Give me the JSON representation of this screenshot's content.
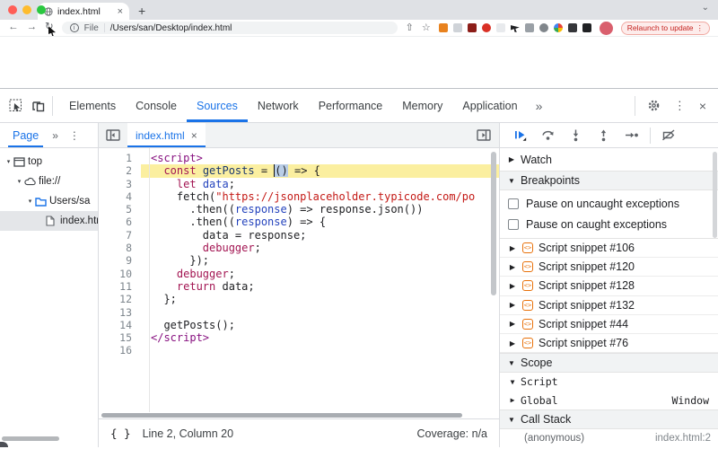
{
  "colors": {
    "accent_blue": "#1a73e8",
    "exec_line_yellow": "#fbefa0",
    "keyword_maroon": "#a31552",
    "tag_purple": "#881280",
    "string_red": "#c41a16",
    "variable_blue": "#2443bd",
    "snippet_orange": "#e8710a",
    "relaunch_red": "#c5221f"
  },
  "browser": {
    "traffic_lights": [
      "#ff5e57",
      "#febc2e",
      "#2ac840"
    ],
    "tab": {
      "title": "index.html",
      "close": "×"
    },
    "new_tab_button": "+",
    "tab_search_chevron": "⌄",
    "nav": {
      "back": "←",
      "forward": "→",
      "reload": "↻"
    },
    "address": {
      "info": "i",
      "scheme_label": "File",
      "path": "/Users/san/Desktop/index.html"
    },
    "actions": {
      "share": "⇧",
      "bookmark": "☆"
    },
    "extensions": [
      {
        "name": "metamask-extension",
        "color": "#e8821e",
        "shape": "square"
      },
      {
        "name": "gray-light-extension",
        "color": "#cfd3d8",
        "shape": "square"
      },
      {
        "name": "dark-red-extension",
        "color": "#8c1d18",
        "shape": "square"
      },
      {
        "name": "red-circle-extension",
        "color": "#d93025",
        "shape": "circle"
      },
      {
        "name": "pale-extension",
        "color": "#e8eaed",
        "shape": "square"
      },
      {
        "name": "cursor-arrow-extension",
        "color": "#202124",
        "shape": "arrow"
      },
      {
        "name": "gray-badge-extension",
        "color": "#9aa0a6",
        "shape": "square"
      },
      {
        "name": "gray-ring-extension",
        "color": "#80868b",
        "shape": "circle"
      },
      {
        "name": "pinwheel-extension",
        "color": "#4285f4",
        "shape": "pinwheel"
      },
      {
        "name": "dark-extension",
        "color": "#35363a",
        "shape": "square"
      },
      {
        "name": "contrast-extension",
        "color": "#202124",
        "shape": "square"
      }
    ],
    "profile": {
      "color": "#d95f6d"
    },
    "relaunch_button": {
      "label": "Relaunch to update",
      "menu": "⋮"
    }
  },
  "devtools": {
    "tabs": [
      "Elements",
      "Console",
      "Sources",
      "Network",
      "Performance",
      "Memory",
      "Application"
    ],
    "active_tab": "Sources",
    "more_tabs": "»",
    "menu": "⋮",
    "close": "×",
    "sidebar": {
      "active_tab": "Page",
      "more": "»",
      "menu": "⋮",
      "tree": [
        {
          "label": "top",
          "icon": "frame",
          "depth": 0,
          "caret": "▾",
          "selected": false
        },
        {
          "label": "file://",
          "icon": "cloud",
          "depth": 1,
          "caret": "▾",
          "selected": false
        },
        {
          "label": "Users/sa",
          "icon": "folder",
          "depth": 2,
          "caret": "▾",
          "selected": false
        },
        {
          "label": "index.html",
          "icon": "file",
          "depth": 3,
          "caret": "",
          "selected": true
        }
      ]
    },
    "editor": {
      "file_tab": {
        "label": "index.html",
        "close": "×"
      },
      "lines": [
        {
          "n": 1,
          "hl": false,
          "toks": [
            [
              "t",
              "<script>"
            ]
          ]
        },
        {
          "n": 2,
          "hl": true,
          "toks": [
            [
              "p",
              "  "
            ],
            [
              "k",
              "const"
            ],
            [
              "p",
              " "
            ],
            [
              "f",
              "getPosts"
            ],
            [
              "p",
              " = "
            ],
            [
              "sel",
              "()"
            ],
            [
              "p",
              " => {"
            ]
          ]
        },
        {
          "n": 3,
          "hl": false,
          "toks": [
            [
              "p",
              "    "
            ],
            [
              "k",
              "let"
            ],
            [
              "p",
              " "
            ],
            [
              "v",
              "data"
            ],
            [
              "p",
              ";"
            ]
          ]
        },
        {
          "n": 4,
          "hl": false,
          "toks": [
            [
              "p",
              "    fetch("
            ],
            [
              "s",
              "\"https://jsonplaceholder.typicode.com/po"
            ]
          ]
        },
        {
          "n": 5,
          "hl": false,
          "toks": [
            [
              "p",
              "      .then(("
            ],
            [
              "v",
              "response"
            ],
            [
              "p",
              ") => response.json())"
            ]
          ]
        },
        {
          "n": 6,
          "hl": false,
          "toks": [
            [
              "p",
              "      .then(("
            ],
            [
              "v",
              "response"
            ],
            [
              "p",
              ") => {"
            ]
          ]
        },
        {
          "n": 7,
          "hl": false,
          "toks": [
            [
              "p",
              "        data = response;"
            ]
          ]
        },
        {
          "n": 8,
          "hl": false,
          "toks": [
            [
              "p",
              "        "
            ],
            [
              "k",
              "debugger"
            ],
            [
              "p",
              ";"
            ]
          ]
        },
        {
          "n": 9,
          "hl": false,
          "toks": [
            [
              "p",
              "      });"
            ]
          ]
        },
        {
          "n": 10,
          "hl": false,
          "toks": [
            [
              "p",
              "    "
            ],
            [
              "k",
              "debugger"
            ],
            [
              "p",
              ";"
            ]
          ]
        },
        {
          "n": 11,
          "hl": false,
          "toks": [
            [
              "p",
              "    "
            ],
            [
              "k",
              "return"
            ],
            [
              "p",
              " data;"
            ]
          ]
        },
        {
          "n": 12,
          "hl": false,
          "toks": [
            [
              "p",
              "  };"
            ]
          ]
        },
        {
          "n": 13,
          "hl": false,
          "toks": []
        },
        {
          "n": 14,
          "hl": false,
          "toks": [
            [
              "p",
              "  getPosts();"
            ]
          ]
        },
        {
          "n": 15,
          "hl": false,
          "toks": [
            [
              "t",
              "</script>"
            ]
          ]
        },
        {
          "n": 16,
          "hl": false,
          "toks": []
        }
      ],
      "status": {
        "line_col": "Line 2, Column 20",
        "coverage": "Coverage: n/a",
        "braces_icon": "{ }"
      }
    },
    "debugger_panel": {
      "watch": {
        "label": "Watch"
      },
      "breakpoints": {
        "label": "Breakpoints",
        "checkboxes": [
          {
            "label": "Pause on uncaught exceptions",
            "checked": false
          },
          {
            "label": "Pause on caught exceptions",
            "checked": false
          }
        ],
        "snippets": [
          "Script snippet #106",
          "Script snippet #120",
          "Script snippet #128",
          "Script snippet #132",
          "Script snippet #44",
          "Script snippet #76"
        ]
      },
      "scope": {
        "label": "Scope",
        "items": [
          {
            "label": "Script",
            "expanded": true,
            "value": ""
          },
          {
            "label": "Global",
            "expanded": false,
            "value": "Window"
          }
        ]
      },
      "call_stack": {
        "label": "Call Stack",
        "frames": [
          {
            "name": "(anonymous)",
            "location": "index.html:2"
          }
        ]
      }
    }
  }
}
